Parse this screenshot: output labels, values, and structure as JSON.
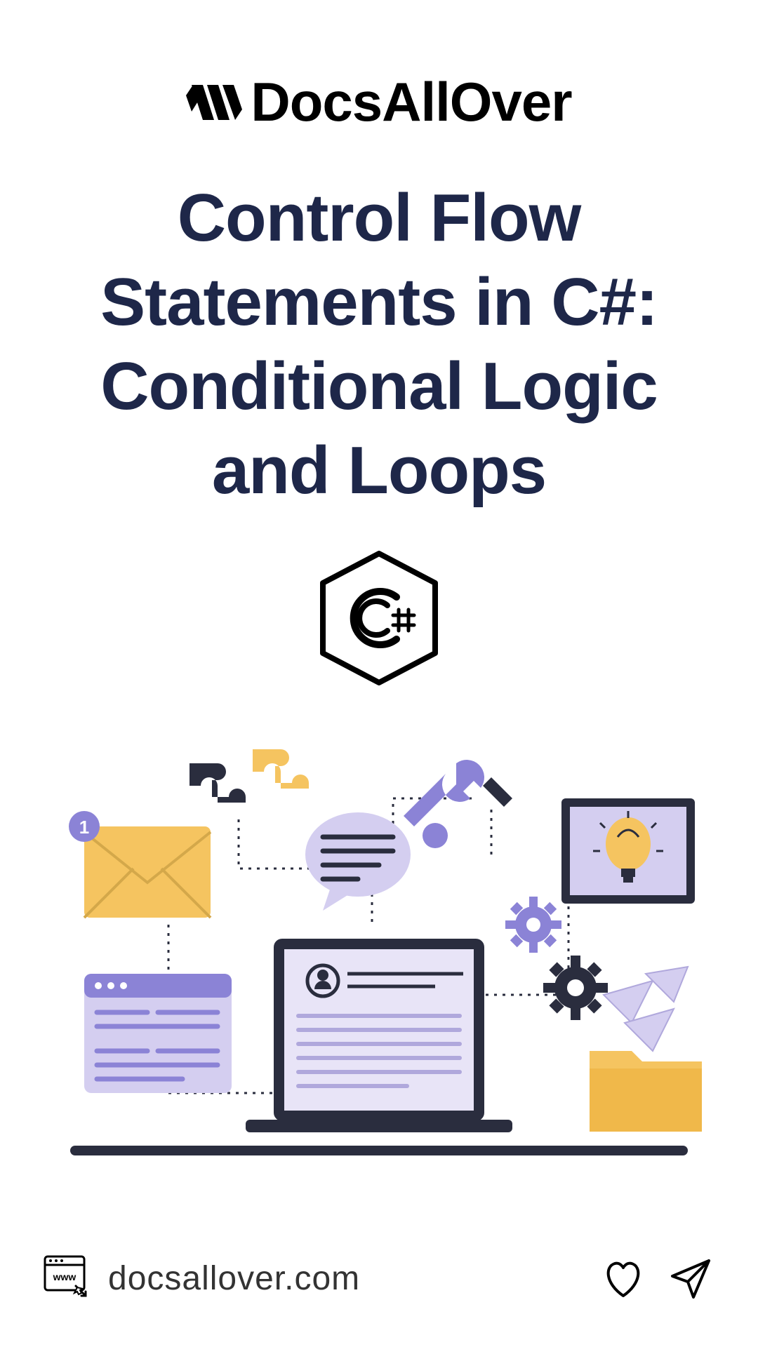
{
  "brand": {
    "name": "DocsAllOver"
  },
  "title": "Control Flow Statements in C#: Conditional Logic and Loops",
  "language_badge": "C#",
  "footer": {
    "url": "docsallover.com"
  },
  "colors": {
    "title": "#1e2749",
    "purple": "#8b83d6",
    "yellow": "#f5c460",
    "dark": "#2a2d3e"
  }
}
